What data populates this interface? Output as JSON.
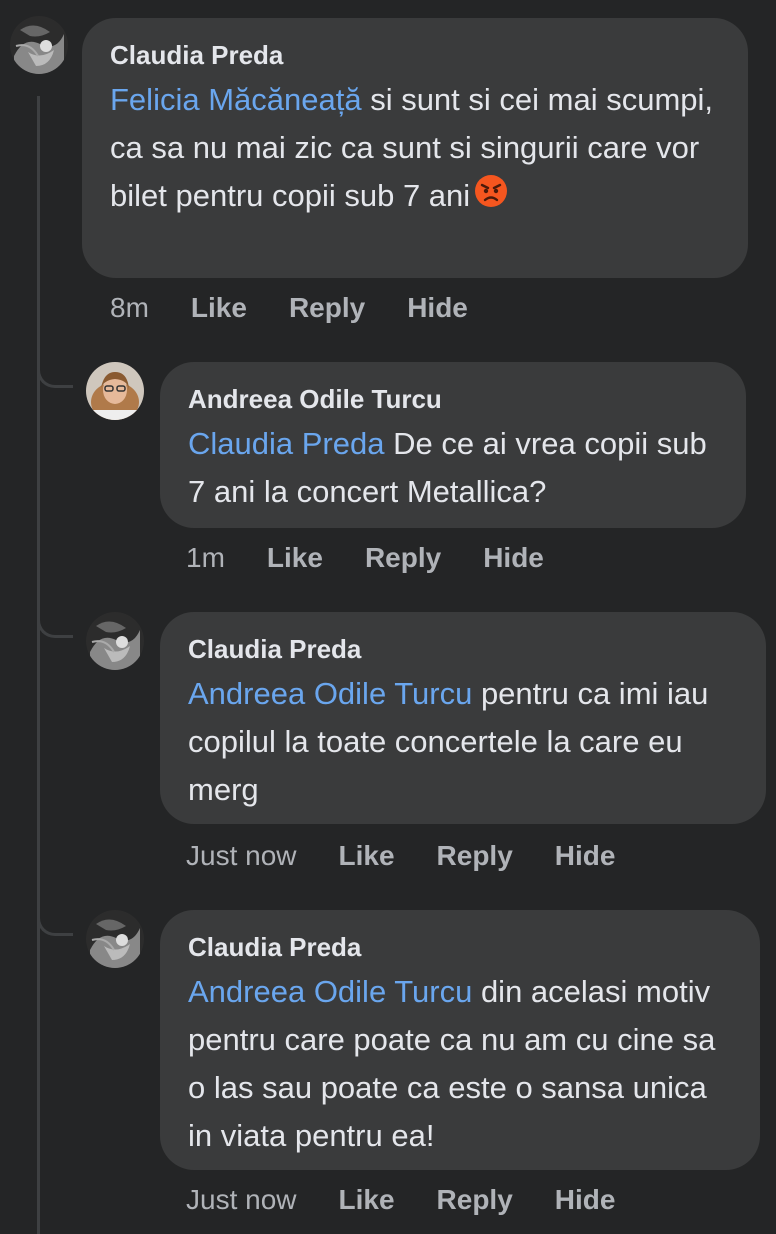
{
  "colors": {
    "background": "#242526",
    "bubble": "#3a3b3c",
    "text": "#e4e6eb",
    "mention": "#6aa6ee",
    "secondary": "#b0b3b8"
  },
  "comments": [
    {
      "author": "Claudia Preda",
      "mention": "Felicia Măcăneață",
      "text": " si sunt si cei mai scumpi, ca sa nu mai zic ca sunt si singurii care vor bilet pentru copii sub 7 ani",
      "emoji": "angry-face-icon",
      "time": "8m",
      "like": "Like",
      "reply": "Reply",
      "hide": "Hide"
    },
    {
      "author": "Andreea Odile Turcu",
      "mention": "Claudia Preda",
      "text": " De ce ai vrea copii sub 7 ani la concert Metallica?",
      "time": "1m",
      "like": "Like",
      "reply": "Reply",
      "hide": "Hide"
    },
    {
      "author": "Claudia Preda",
      "mention": "Andreea Odile Turcu",
      "text": " pentru ca imi iau copilul la toate concertele la care eu merg",
      "time": "Just now",
      "like": "Like",
      "reply": "Reply",
      "hide": "Hide"
    },
    {
      "author": "Claudia Preda",
      "mention": "Andreea Odile Turcu",
      "text": " din acelasi motiv pentru care poate ca nu am cu cine sa o las sau poate ca este o sansa unica in viata pentru ea!",
      "time": "Just now",
      "like": "Like",
      "reply": "Reply",
      "hide": "Hide"
    }
  ]
}
